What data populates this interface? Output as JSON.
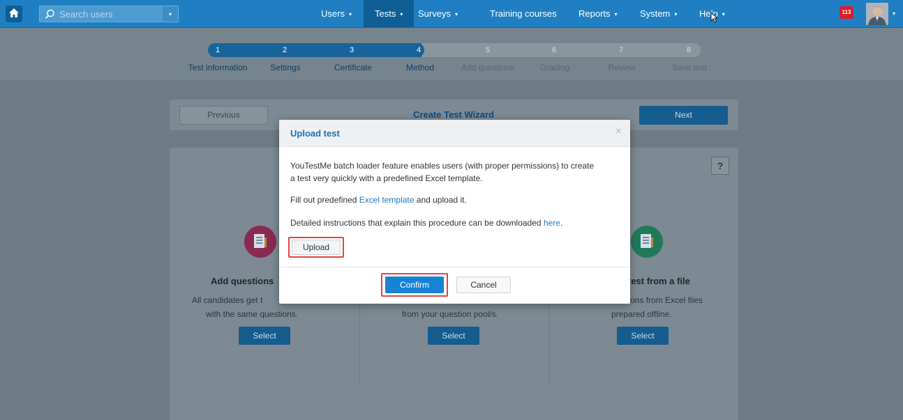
{
  "navbar": {
    "search_placeholder": "Search users",
    "menu": [
      {
        "label": "Users",
        "has_caret": true
      },
      {
        "label": "Tests",
        "has_caret": true,
        "active": true
      },
      {
        "label": "Surveys",
        "has_caret": true
      },
      {
        "label": "Training courses",
        "has_caret": false
      },
      {
        "label": "Reports",
        "has_caret": true
      },
      {
        "label": "System",
        "has_caret": true
      },
      {
        "label": "Help",
        "has_caret": true
      }
    ],
    "notification_count": "113",
    "caret_glyph": "▾",
    "colors": {
      "bar": "#1f7fc2",
      "active": "#0f5e96",
      "badge": "#d81e2c"
    }
  },
  "wizard": {
    "current_step": 4,
    "steps": [
      {
        "num": "1",
        "label": "Test information",
        "done": true
      },
      {
        "num": "2",
        "label": "Settings",
        "done": true
      },
      {
        "num": "3",
        "label": "Certificate",
        "done": true
      },
      {
        "num": "4",
        "label": "Method",
        "done": true
      },
      {
        "num": "5",
        "label": "Add questions",
        "done": false
      },
      {
        "num": "6",
        "label": "Grading",
        "done": false
      },
      {
        "num": "7",
        "label": "Review",
        "done": false
      },
      {
        "num": "8",
        "label": "Save test",
        "done": false
      }
    ],
    "title": "Create Test Wizard",
    "previous_label": "Previous",
    "next_label": "Next"
  },
  "main": {
    "help_label": "?",
    "options": [
      {
        "title": "Add questions",
        "desc_line1": "All candidates get t",
        "desc_line2": "with the same questions.",
        "select_label": "Select",
        "icon": "document-icon",
        "icon_color": "#8a2a52"
      },
      {
        "title": "",
        "desc_line1": "",
        "desc_line2": "from your question pool/s.",
        "select_label": "Select",
        "icon": "",
        "icon_color": ""
      },
      {
        "title": "test from a file",
        "desc_line1": "ons from Excel files",
        "desc_line2": "prepared offline.",
        "select_label": "Select",
        "icon": "document-icon",
        "icon_color": "#1f7a5a"
      }
    ]
  },
  "modal": {
    "title": "Upload test",
    "close_glyph": "×",
    "para1_line1": "YouTestMe batch loader feature enables users (with proper permissions) to create",
    "para1_line2": "a test very quickly with a predefined Excel template.",
    "para2_before": "Fill out predefined ",
    "para2_link": "Excel template",
    "para2_after": " and upload it.",
    "para3_before": "Detailed instructions that explain this procedure can be downloaded ",
    "para3_link": "here",
    "para3_after": ".",
    "upload_label": "Upload",
    "confirm_label": "Confirm",
    "cancel_label": "Cancel",
    "highlight_color": "#e04545"
  }
}
